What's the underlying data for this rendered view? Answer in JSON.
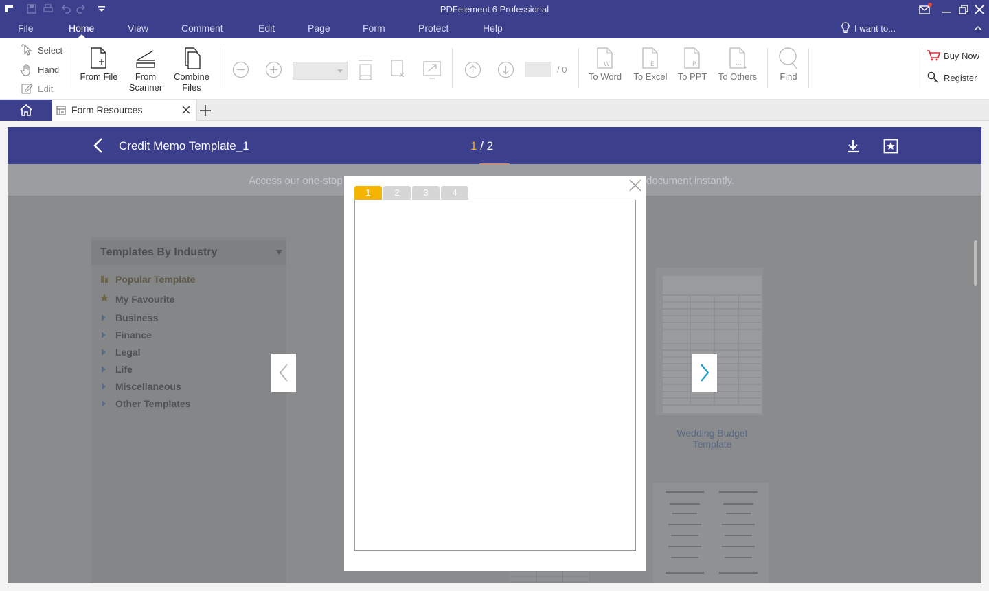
{
  "app": {
    "title": "PDFelement 6 Professional"
  },
  "menu": {
    "items": [
      "File",
      "Home",
      "View",
      "Comment",
      "Edit",
      "Page",
      "Form",
      "Protect",
      "Help"
    ],
    "active": "Home",
    "search_hint": "I want to..."
  },
  "ribbon": {
    "select": "Select",
    "hand": "Hand",
    "edit": "Edit",
    "from_file": "From File",
    "from_scanner_1": "From",
    "from_scanner_2": "Scanner",
    "combine_1": "Combine",
    "combine_2": "Files",
    "page_total": "/ 0",
    "to_word": "To Word",
    "to_excel": "To Excel",
    "to_ppt": "To PPT",
    "to_others": "To Others",
    "find": "Find",
    "buy_now": "Buy Now",
    "register": "Register"
  },
  "tabs": {
    "doc_tab_label": "Form Resources"
  },
  "viewer": {
    "doc_title": "Credit Memo Template_1",
    "current_page": "1",
    "total_pages": "/ 2",
    "banner_left": "Access our one-stop",
    "banner_right": "document instantly."
  },
  "sidebar": {
    "title": "Templates By Industry",
    "items": [
      "Popular Template",
      "My Favourite",
      "Business",
      "Finance",
      "Legal",
      "Life",
      "Miscellaneous",
      "Other Templates"
    ]
  },
  "cards": {
    "wedding_caption_1": "Wedding Budget",
    "wedding_caption_2": "Template"
  },
  "modal": {
    "tabs": [
      "1",
      "2",
      "3",
      "4"
    ],
    "active_tab": "1"
  },
  "colors": {
    "brand": "#3b3f8c",
    "accent": "#f4b400",
    "arrow_active": "#1a9bc7"
  }
}
